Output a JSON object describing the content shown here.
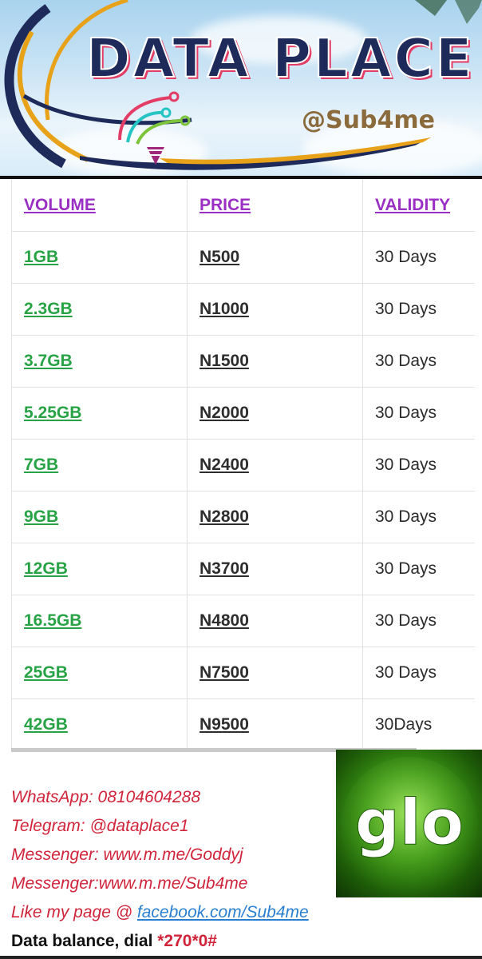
{
  "banner": {
    "title": "DATA PLACE",
    "handle": "@Sub4me"
  },
  "table": {
    "headers": [
      "VOLUME",
      "PRICE",
      "VALIDITY"
    ],
    "rows": [
      {
        "volume": "1GB",
        "price": "N500",
        "validity": "30 Days"
      },
      {
        "volume": "2.3GB",
        "price": "N1000",
        "validity": "30 Days"
      },
      {
        "volume": "3.7GB",
        "price": "N1500",
        "validity": "30 Days"
      },
      {
        "volume": "5.25GB",
        "price": "N2000",
        "validity": "30 Days"
      },
      {
        "volume": "7GB",
        "price": "N2400",
        "validity": "30 Days"
      },
      {
        "volume": "9GB",
        "price": "N2800",
        "validity": "30 Days"
      },
      {
        "volume": "12GB",
        "price": "N3700",
        "validity": "30 Days"
      },
      {
        "volume": "16.5GB",
        "price": "N4800",
        "validity": "30 Days"
      },
      {
        "volume": "25GB",
        "price": "N7500",
        "validity": "30 Days"
      },
      {
        "volume": "42GB",
        "price": "N9500",
        "validity": "30Days"
      }
    ]
  },
  "contacts": {
    "whatsapp": "WhatsApp: 08104604288",
    "telegram": "Telegram: @dataplace1",
    "messenger1": "Messenger: www.m.me/Goddyj",
    "messenger2": "Messenger:www.m.me/Sub4me",
    "like_prefix": "Like my page @ ",
    "facebook_link": "facebook.com/Sub4me",
    "balance_prefix": "Data balance,  dial ",
    "balance_code": "*270*0#"
  },
  "logo": {
    "text": "glo"
  },
  "colors": {
    "header_purple": "#9b2fc4",
    "volume_green": "#27a345",
    "contact_red": "#d0243a",
    "link_blue": "#2a7fd0"
  }
}
